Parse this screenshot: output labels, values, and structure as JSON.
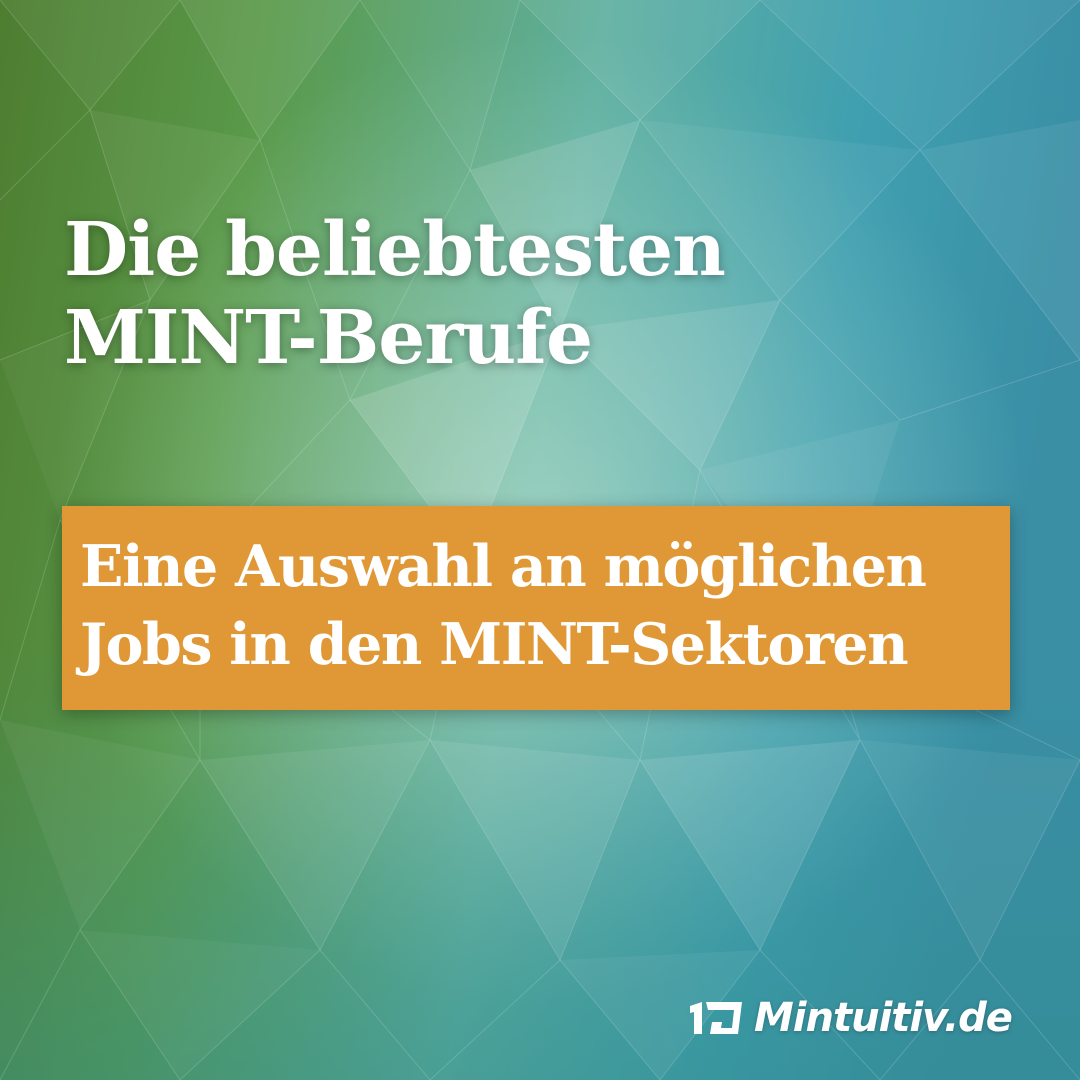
{
  "headline": {
    "line1": "Die beliebtesten",
    "line2": "MINT-Berufe"
  },
  "subtitle": {
    "line1": "Eine Auswahl an möglichen",
    "line2": "Jobs in den MINT-Sektoren"
  },
  "brand": {
    "name": "Mintuitiv.de",
    "logo_icon": "mintuitiv-logo-icon"
  },
  "colors": {
    "subtitle_box": "#e09836",
    "text": "#ffffff",
    "background_green": "#4f8a3a",
    "background_teal": "#3aa5b0",
    "background_blue": "#4fb0cc"
  }
}
